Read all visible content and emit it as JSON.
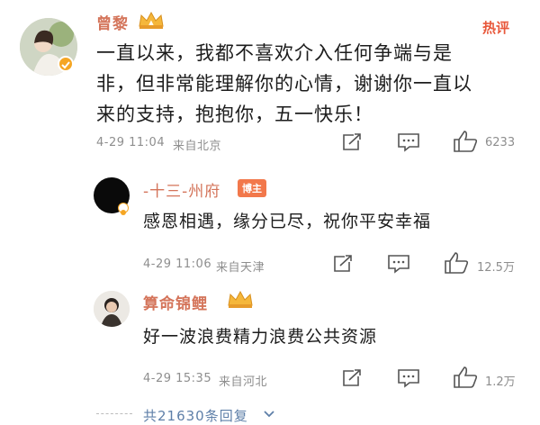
{
  "post": {
    "author": "曾黎",
    "hot_tag": "热评",
    "text": "一直以来，我都不喜欢介入任何争端与是非，但非常能理解你的心情，谢谢你一直以来的支持，抱抱你，五一快乐！",
    "line1": "一直以来，我都不喜欢介入任何争端与是",
    "line2": "非，但非常能理解你的心情，谢谢你一直以",
    "line3": "来的支持，抱抱你，五一快乐！",
    "timestamp": "4-29 11:04",
    "location": "来自北京",
    "like_count": "6233"
  },
  "replies": [
    {
      "author": "-十三-州府",
      "badge": "博主",
      "text": "感恩相遇，缘分已尽，祝你平安幸福",
      "timestamp": "4-29 11:06",
      "location": "来自天津",
      "like_count": "12.5万"
    },
    {
      "author": "算命锦鲤",
      "text": "好一波浪费精力浪费公共资源",
      "timestamp": "4-29 15:35",
      "location": "来自河北",
      "like_count": "1.2万"
    }
  ],
  "footer": {
    "more_replies": "共21630条回复"
  },
  "colors": {
    "name": "#d4745a",
    "hot": "#e8583b",
    "host_badge": "#f2784b",
    "verified": "#f5a623",
    "link": "#5e7fa8"
  },
  "icons": [
    "crown-icon",
    "share-icon",
    "comment-icon",
    "like-icon",
    "verified-icon",
    "chevron-down-icon"
  ]
}
